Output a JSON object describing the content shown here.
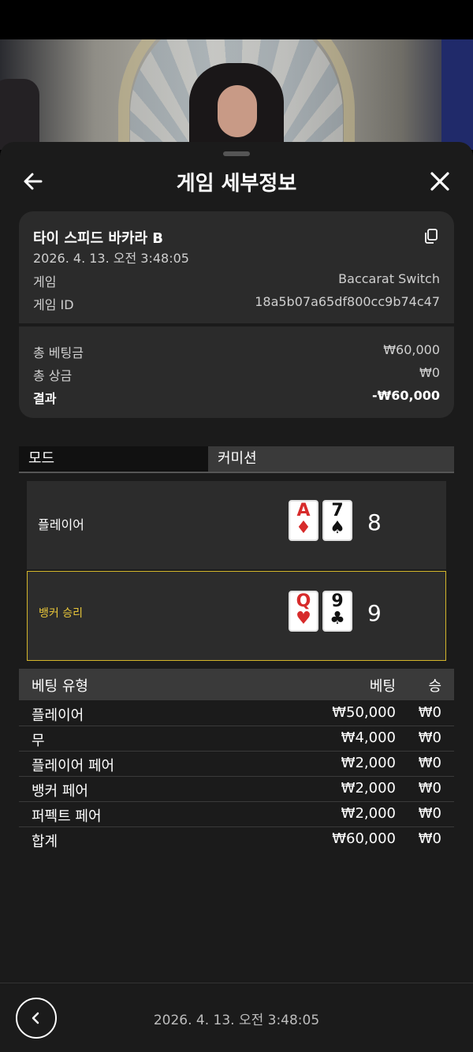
{
  "header": {
    "title": "게임 세부정보"
  },
  "game": {
    "name": "타이 스피드 바카라 B",
    "datetime": "2026. 4. 13. 오전 3:48:05",
    "game_label": "게임",
    "game_value": "Baccarat Switch",
    "id_label": "게임 ID",
    "id_value": "18a5b07a65df800cc9b74c47"
  },
  "summary": {
    "total_bet_label": "총 베팅금",
    "total_bet_value": "₩60,000",
    "total_win_label": "총 상금",
    "total_win_value": "₩0",
    "result_label": "결과",
    "result_value": "-₩60,000"
  },
  "tabs": {
    "mode": "모드",
    "commission": "커미션"
  },
  "hands": {
    "player": {
      "label": "플레이어",
      "cards": [
        {
          "rank": "A",
          "suit": "♦"
        },
        {
          "rank": "7",
          "suit": "♠"
        }
      ],
      "score": "8"
    },
    "banker": {
      "label": "뱅커 승리",
      "cards": [
        {
          "rank": "Q",
          "suit": "♥"
        },
        {
          "rank": "9",
          "suit": "♣"
        }
      ],
      "score": "9"
    }
  },
  "bets": {
    "headers": {
      "type": "베팅 유형",
      "bet": "베팅",
      "win": "승"
    },
    "rows": [
      {
        "type": "플레이어",
        "bet": "₩50,000",
        "win": "₩0"
      },
      {
        "type": "무",
        "bet": "₩4,000",
        "win": "₩0"
      },
      {
        "type": "플레이어 페어",
        "bet": "₩2,000",
        "win": "₩0"
      },
      {
        "type": "뱅커 페어",
        "bet": "₩2,000",
        "win": "₩0"
      },
      {
        "type": "퍼펙트 페어",
        "bet": "₩2,000",
        "win": "₩0"
      }
    ],
    "total": {
      "type": "합계",
      "bet": "₩60,000",
      "win": "₩0"
    }
  },
  "footer": {
    "datetime": "2026. 4. 13. 오전 3:48:05"
  },
  "colors": {
    "sheet_bg": "#1b1b1b",
    "card_bg": "#2b2b2b",
    "banker_highlight": "#d4b62a",
    "red_suit": "#d72b2b"
  }
}
